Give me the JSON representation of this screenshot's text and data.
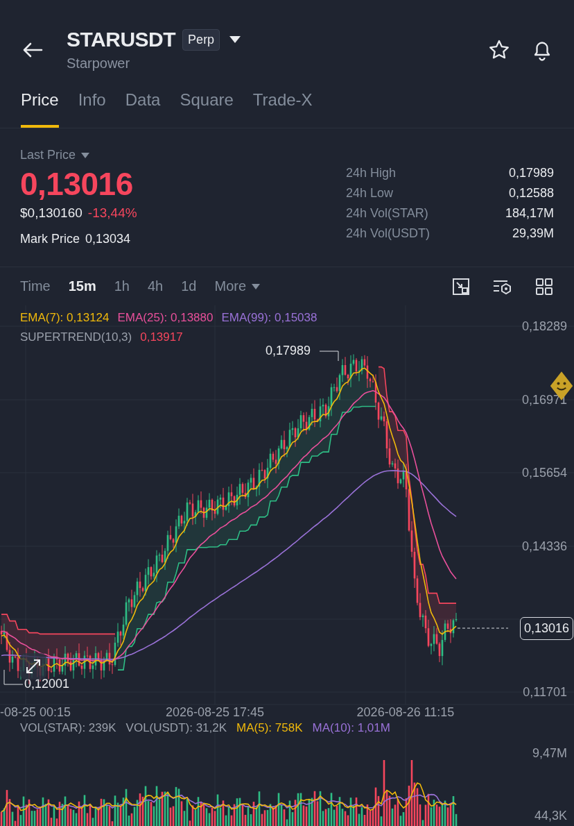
{
  "header": {
    "symbol": "STARUSDT",
    "badge": "Perp",
    "subtitle": "Starpower"
  },
  "tabs": [
    {
      "label": "Price",
      "selected": true
    },
    {
      "label": "Info",
      "selected": false
    },
    {
      "label": "Data",
      "selected": false
    },
    {
      "label": "Square",
      "selected": false
    },
    {
      "label": "Trade-X",
      "selected": false
    }
  ],
  "last_price": {
    "label": "Last Price",
    "value": "0,13016",
    "usd": "$0,130160",
    "change": "-13,44%",
    "mark_label": "Mark Price",
    "mark_value": "0,13034"
  },
  "stats": [
    {
      "label": "24h High",
      "value": "0,17989"
    },
    {
      "label": "24h Low",
      "value": "0,12588"
    },
    {
      "label": "24h Vol(STAR)",
      "value": "184,17M"
    },
    {
      "label": "24h Vol(USDT)",
      "value": "29,39M"
    }
  ],
  "intervals": [
    {
      "label": "Time",
      "kind": "option",
      "selected": false
    },
    {
      "label": "15m",
      "kind": "option",
      "selected": true
    },
    {
      "label": "1h",
      "kind": "option",
      "selected": false
    },
    {
      "label": "4h",
      "kind": "option",
      "selected": false
    },
    {
      "label": "1d",
      "kind": "option",
      "selected": false
    },
    {
      "label": "More",
      "kind": "dropdown",
      "selected": false
    }
  ],
  "chart": {
    "legend": [
      {
        "label": "EMA(7): 0,13124",
        "color": "#f0b90b"
      },
      {
        "label": "EMA(25): 0,13880",
        "color": "#e9509b"
      },
      {
        "label": "EMA(99): 0,15038",
        "color": "#9a72d8"
      }
    ],
    "supertrend": {
      "label": "SUPERTREND(10,3)",
      "value": "0,13917"
    },
    "y_labels": [
      "0,18289",
      "0,16971",
      "0,15654",
      "0,14336",
      "0,11701"
    ],
    "x_labels": [
      "-08-25 00:15",
      "2026-08-25 17:45",
      "2026-08-26 11:15"
    ],
    "high_marker": "0,17989",
    "low_marker": "0,12001",
    "last_tag": "0,13016"
  },
  "volume": {
    "legend": [
      {
        "label": "VOL(STAR): 239K",
        "color": "#9aa0ab"
      },
      {
        "label": "VOL(USDT): 31,2K",
        "color": "#9aa0ab"
      },
      {
        "label": "MA(5): 758K",
        "color": "#f0b90b"
      },
      {
        "label": "MA(10): 1,01M",
        "color": "#9a72d8"
      }
    ],
    "y_labels": [
      "9,47M",
      "44,3K"
    ]
  }
}
